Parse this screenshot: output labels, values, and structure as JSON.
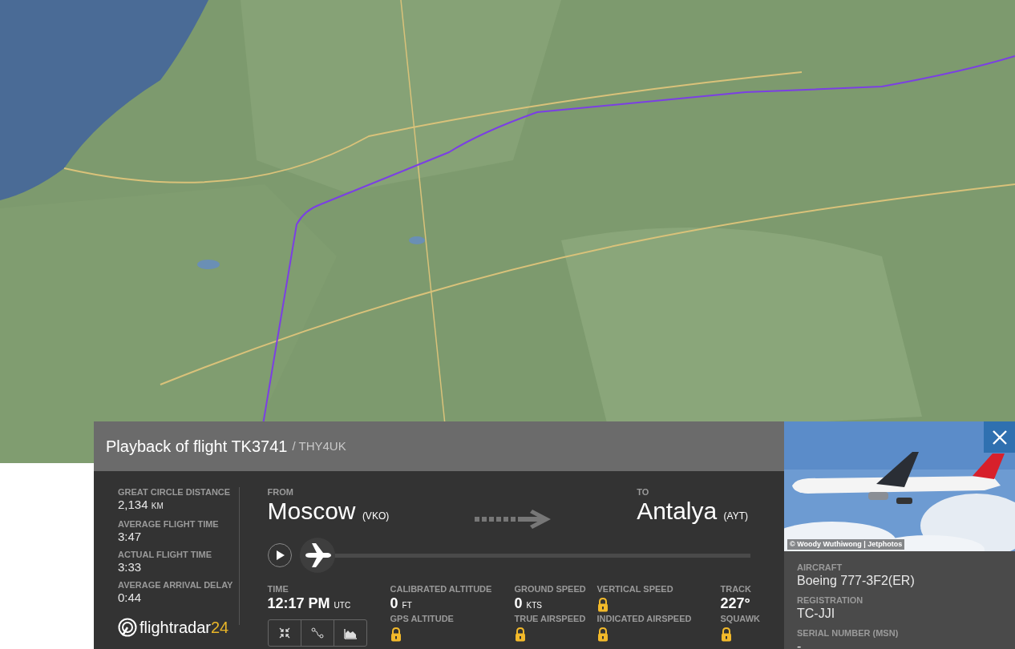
{
  "panel": {
    "title": "Playback of flight TK3741",
    "callsign": "/ THY4UK"
  },
  "stats": [
    {
      "label": "GREAT CIRCLE DISTANCE",
      "value": "2,134",
      "unit": "KM"
    },
    {
      "label": "AVERAGE FLIGHT TIME",
      "value": "3:47"
    },
    {
      "label": "ACTUAL FLIGHT TIME",
      "value": "3:33"
    },
    {
      "label": "AVERAGE ARRIVAL DELAY",
      "value": "0:44"
    }
  ],
  "logo": {
    "text": "flightradar",
    "accent": "24"
  },
  "route": {
    "from": {
      "label": "FROM",
      "city": "Moscow",
      "code": "(VKO)"
    },
    "to": {
      "label": "TO",
      "city": "Antalya",
      "code": "(AYT)"
    }
  },
  "playback": {
    "playing": false,
    "level": 0.0
  },
  "time": {
    "label": "TIME",
    "value": "12:17 PM",
    "unit": "UTC"
  },
  "readings": [
    [
      {
        "label": "CALIBRATED ALTITUDE",
        "value": "0",
        "unit": "FT",
        "locked": false
      },
      {
        "label": "GPS ALTITUDE",
        "locked": true
      }
    ],
    [
      {
        "label": "GROUND SPEED",
        "value": "0",
        "unit": "KTS",
        "locked": false
      },
      {
        "label": "TRUE AIRSPEED",
        "locked": true
      }
    ],
    [
      {
        "label": "VERTICAL SPEED",
        "locked": true
      },
      {
        "label": "INDICATED AIRSPEED",
        "locked": true
      }
    ],
    [
      {
        "label": "TRACK",
        "value": "227°",
        "locked": false
      },
      {
        "label": "SQUAWK",
        "locked": true
      }
    ]
  ],
  "photo": {
    "kind": "picture",
    "credit": "© Woody Wuthiwong | Jetphotos"
  },
  "aircraft": [
    {
      "label": "AIRCRAFT",
      "value": "Boeing 777-3F2(ER)"
    },
    {
      "label": "REGISTRATION",
      "value": "TC-JJI"
    },
    {
      "label": "SERIAL NUMBER (MSN)",
      "value": "-"
    }
  ]
}
